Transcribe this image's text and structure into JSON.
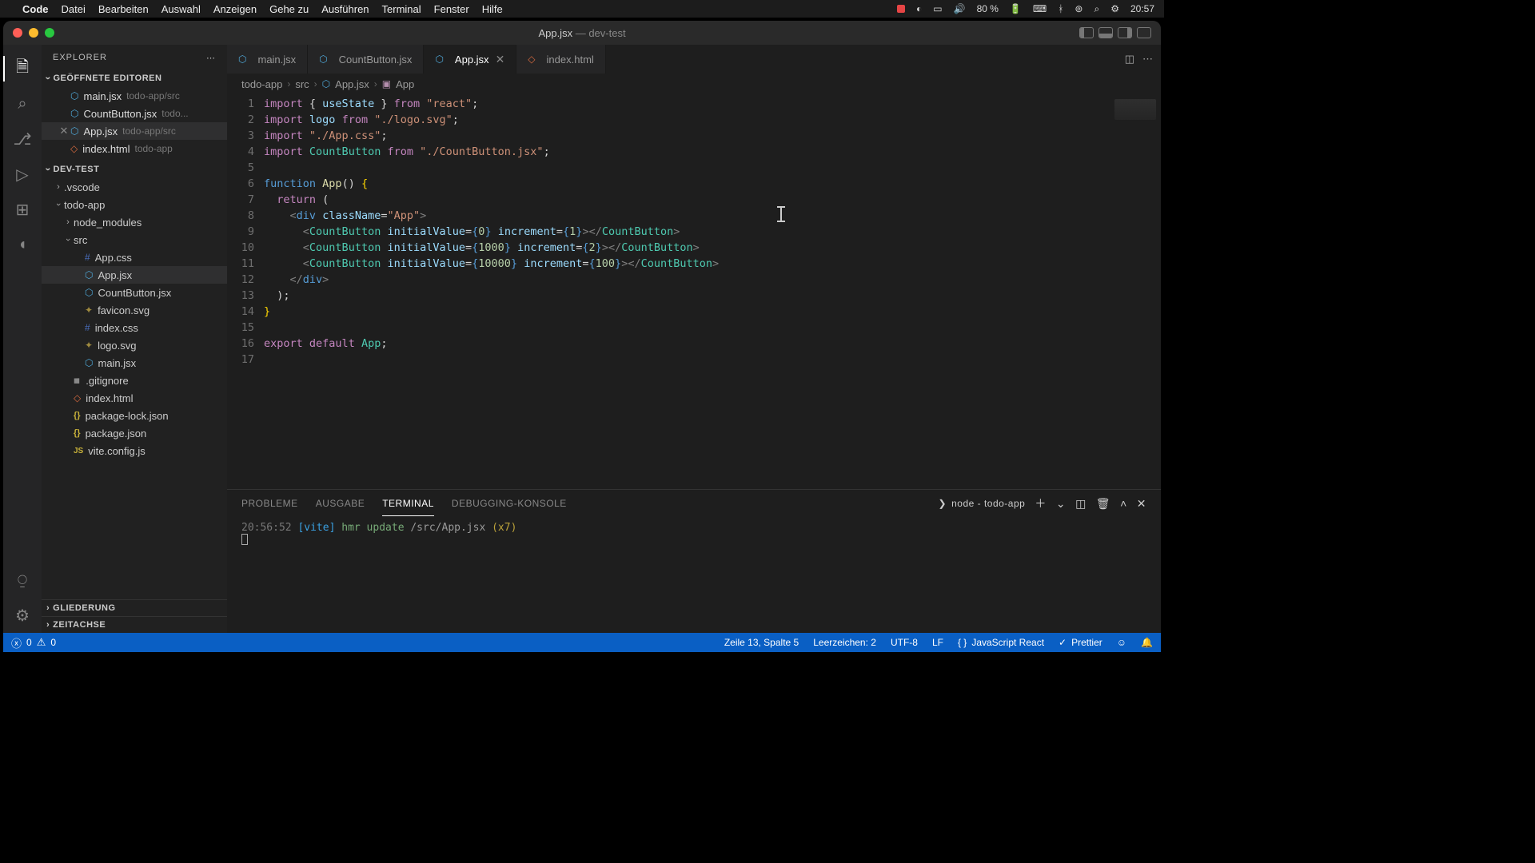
{
  "menubar": {
    "app": "Code",
    "items": [
      "Datei",
      "Bearbeiten",
      "Auswahl",
      "Anzeigen",
      "Gehe zu",
      "Ausführen",
      "Terminal",
      "Fenster",
      "Hilfe"
    ],
    "battery": "80 %",
    "clock": "20:57"
  },
  "title": {
    "file": "App.jsx",
    "sep": " — ",
    "project": "dev-test"
  },
  "sidebar": {
    "header": "EXPLORER",
    "openEditorsLabel": "GEÖFFNETE EDITOREN",
    "openEditors": [
      {
        "name": "main.jsx",
        "path": "todo-app/src",
        "icon": "react",
        "active": false,
        "close": false
      },
      {
        "name": "CountButton.jsx",
        "path": "todo...",
        "icon": "react",
        "active": false,
        "close": false
      },
      {
        "name": "App.jsx",
        "path": "todo-app/src",
        "icon": "react",
        "active": true,
        "close": true
      },
      {
        "name": "index.html",
        "path": "todo-app",
        "icon": "html",
        "active": false,
        "close": false
      }
    ],
    "projectLabel": "DEV-TEST",
    "tree": [
      {
        "depth": 0,
        "chev": "closed",
        "icon": "",
        "name": ".vscode"
      },
      {
        "depth": 0,
        "chev": "open",
        "icon": "",
        "name": "todo-app"
      },
      {
        "depth": 1,
        "chev": "closed",
        "icon": "",
        "name": "node_modules"
      },
      {
        "depth": 1,
        "chev": "open",
        "icon": "",
        "name": "src"
      },
      {
        "depth": 2,
        "chev": "",
        "icon": "css",
        "name": "App.css"
      },
      {
        "depth": 2,
        "chev": "",
        "icon": "react",
        "name": "App.jsx",
        "selected": true
      },
      {
        "depth": 2,
        "chev": "",
        "icon": "react",
        "name": "CountButton.jsx"
      },
      {
        "depth": 2,
        "chev": "",
        "icon": "svg",
        "name": "favicon.svg"
      },
      {
        "depth": 2,
        "chev": "",
        "icon": "css",
        "name": "index.css"
      },
      {
        "depth": 2,
        "chev": "",
        "icon": "svg",
        "name": "logo.svg"
      },
      {
        "depth": 2,
        "chev": "",
        "icon": "react",
        "name": "main.jsx"
      },
      {
        "depth": 1,
        "chev": "",
        "icon": "git",
        "name": ".gitignore"
      },
      {
        "depth": 1,
        "chev": "",
        "icon": "html",
        "name": "index.html"
      },
      {
        "depth": 1,
        "chev": "",
        "icon": "json",
        "name": "package-lock.json"
      },
      {
        "depth": 1,
        "chev": "",
        "icon": "json",
        "name": "package.json"
      },
      {
        "depth": 1,
        "chev": "",
        "icon": "js",
        "name": "vite.config.js"
      }
    ],
    "outlineLabel": "GLIEDERUNG",
    "timelineLabel": "ZEITACHSE"
  },
  "tabs": [
    {
      "name": "main.jsx",
      "icon": "react",
      "active": false
    },
    {
      "name": "CountButton.jsx",
      "icon": "react",
      "active": false
    },
    {
      "name": "App.jsx",
      "icon": "react",
      "active": true
    },
    {
      "name": "index.html",
      "icon": "html",
      "active": false
    }
  ],
  "breadcrumbs": [
    "todo-app",
    "src",
    "App.jsx",
    "App"
  ],
  "code": {
    "lines": 17,
    "content": [
      {
        "n": 1,
        "t": [
          [
            "keyword",
            "import"
          ],
          [
            "punc",
            " { "
          ],
          [
            "attr",
            "useState"
          ],
          [
            "punc",
            " } "
          ],
          [
            "keyword",
            "from"
          ],
          [
            "punc",
            " "
          ],
          [
            "string",
            "\"react\""
          ],
          [
            "punc",
            ";"
          ]
        ]
      },
      {
        "n": 2,
        "t": [
          [
            "keyword",
            "import"
          ],
          [
            "punc",
            " "
          ],
          [
            "attr",
            "logo"
          ],
          [
            "punc",
            " "
          ],
          [
            "keyword",
            "from"
          ],
          [
            "punc",
            " "
          ],
          [
            "string",
            "\"./logo.svg\""
          ],
          [
            "punc",
            ";"
          ]
        ]
      },
      {
        "n": 3,
        "t": [
          [
            "keyword",
            "import"
          ],
          [
            "punc",
            " "
          ],
          [
            "string",
            "\"./App.css\""
          ],
          [
            "punc",
            ";"
          ]
        ]
      },
      {
        "n": 4,
        "t": [
          [
            "keyword",
            "import"
          ],
          [
            "punc",
            " "
          ],
          [
            "type",
            "CountButton"
          ],
          [
            "punc",
            " "
          ],
          [
            "keyword",
            "from"
          ],
          [
            "punc",
            " "
          ],
          [
            "string",
            "\"./CountButton.jsx\""
          ],
          [
            "punc",
            ";"
          ]
        ]
      },
      {
        "n": 5,
        "t": []
      },
      {
        "n": 6,
        "t": [
          [
            "keyword2",
            "function"
          ],
          [
            "punc",
            " "
          ],
          [
            "func",
            "App"
          ],
          [
            "punc",
            "()"
          ],
          [
            "punc",
            " "
          ],
          [
            "brace",
            "{"
          ]
        ]
      },
      {
        "n": 7,
        "t": [
          [
            "punc",
            "  "
          ],
          [
            "keyword",
            "return"
          ],
          [
            "punc",
            " ("
          ]
        ]
      },
      {
        "n": 8,
        "t": [
          [
            "punc",
            "    "
          ],
          [
            "angle",
            "<"
          ],
          [
            "keyword2",
            "div"
          ],
          [
            "punc",
            " "
          ],
          [
            "attr",
            "className"
          ],
          [
            "punc",
            "="
          ],
          [
            "string",
            "\"App\""
          ],
          [
            "angle",
            ">"
          ]
        ]
      },
      {
        "n": 9,
        "t": [
          [
            "punc",
            "      "
          ],
          [
            "angle",
            "<"
          ],
          [
            "tag",
            "CountButton"
          ],
          [
            "punc",
            " "
          ],
          [
            "attr",
            "initialValue"
          ],
          [
            "punc",
            "="
          ],
          [
            "keyword2",
            "{"
          ],
          [
            "num",
            "0"
          ],
          [
            "keyword2",
            "}"
          ],
          [
            "punc",
            " "
          ],
          [
            "attr",
            "increment"
          ],
          [
            "punc",
            "="
          ],
          [
            "keyword2",
            "{"
          ],
          [
            "num",
            "1"
          ],
          [
            "keyword2",
            "}"
          ],
          [
            "angle",
            "></"
          ],
          [
            "tag",
            "CountButton"
          ],
          [
            "angle",
            ">"
          ]
        ]
      },
      {
        "n": 10,
        "t": [
          [
            "punc",
            "      "
          ],
          [
            "angle",
            "<"
          ],
          [
            "tag",
            "CountButton"
          ],
          [
            "punc",
            " "
          ],
          [
            "attr",
            "initialValue"
          ],
          [
            "punc",
            "="
          ],
          [
            "keyword2",
            "{"
          ],
          [
            "num",
            "1000"
          ],
          [
            "keyword2",
            "}"
          ],
          [
            "punc",
            " "
          ],
          [
            "attr",
            "increment"
          ],
          [
            "punc",
            "="
          ],
          [
            "keyword2",
            "{"
          ],
          [
            "num",
            "2"
          ],
          [
            "keyword2",
            "}"
          ],
          [
            "angle",
            "></"
          ],
          [
            "tag",
            "CountButton"
          ],
          [
            "angle",
            ">"
          ]
        ]
      },
      {
        "n": 11,
        "t": [
          [
            "punc",
            "      "
          ],
          [
            "angle",
            "<"
          ],
          [
            "tag",
            "CountButton"
          ],
          [
            "punc",
            " "
          ],
          [
            "attr",
            "initialValue"
          ],
          [
            "punc",
            "="
          ],
          [
            "keyword2",
            "{"
          ],
          [
            "num",
            "10000"
          ],
          [
            "keyword2",
            "}"
          ],
          [
            "punc",
            " "
          ],
          [
            "attr",
            "increment"
          ],
          [
            "punc",
            "="
          ],
          [
            "keyword2",
            "{"
          ],
          [
            "num",
            "100"
          ],
          [
            "keyword2",
            "}"
          ],
          [
            "angle",
            "></"
          ],
          [
            "tag",
            "CountButton"
          ],
          [
            "angle",
            ">"
          ]
        ]
      },
      {
        "n": 12,
        "t": [
          [
            "punc",
            "    "
          ],
          [
            "angle",
            "</"
          ],
          [
            "keyword2",
            "div"
          ],
          [
            "angle",
            ">"
          ]
        ]
      },
      {
        "n": 13,
        "t": [
          [
            "punc",
            "  );"
          ]
        ]
      },
      {
        "n": 14,
        "t": [
          [
            "brace",
            "}"
          ]
        ]
      },
      {
        "n": 15,
        "t": []
      },
      {
        "n": 16,
        "t": [
          [
            "keyword",
            "export"
          ],
          [
            "punc",
            " "
          ],
          [
            "keyword",
            "default"
          ],
          [
            "punc",
            " "
          ],
          [
            "type",
            "App"
          ],
          [
            "punc",
            ";"
          ]
        ]
      },
      {
        "n": 17,
        "t": []
      }
    ]
  },
  "panel": {
    "tabs": [
      "PROBLEME",
      "AUSGABE",
      "TERMINAL",
      "DEBUGGING-KONSOLE"
    ],
    "activeTab": 2,
    "terminalLabel": "node - todo-app",
    "line": {
      "time": "20:56:52",
      "tag": "[vite]",
      "msg": "hmr update",
      "path": "/src/App.jsx",
      "count": "(x7)"
    }
  },
  "status": {
    "errors": "0",
    "warnings": "0",
    "pos": "Zeile 13, Spalte 5",
    "spaces": "Leerzeichen: 2",
    "encoding": "UTF-8",
    "eol": "LF",
    "lang": "JavaScript React",
    "prettier": "Prettier"
  }
}
